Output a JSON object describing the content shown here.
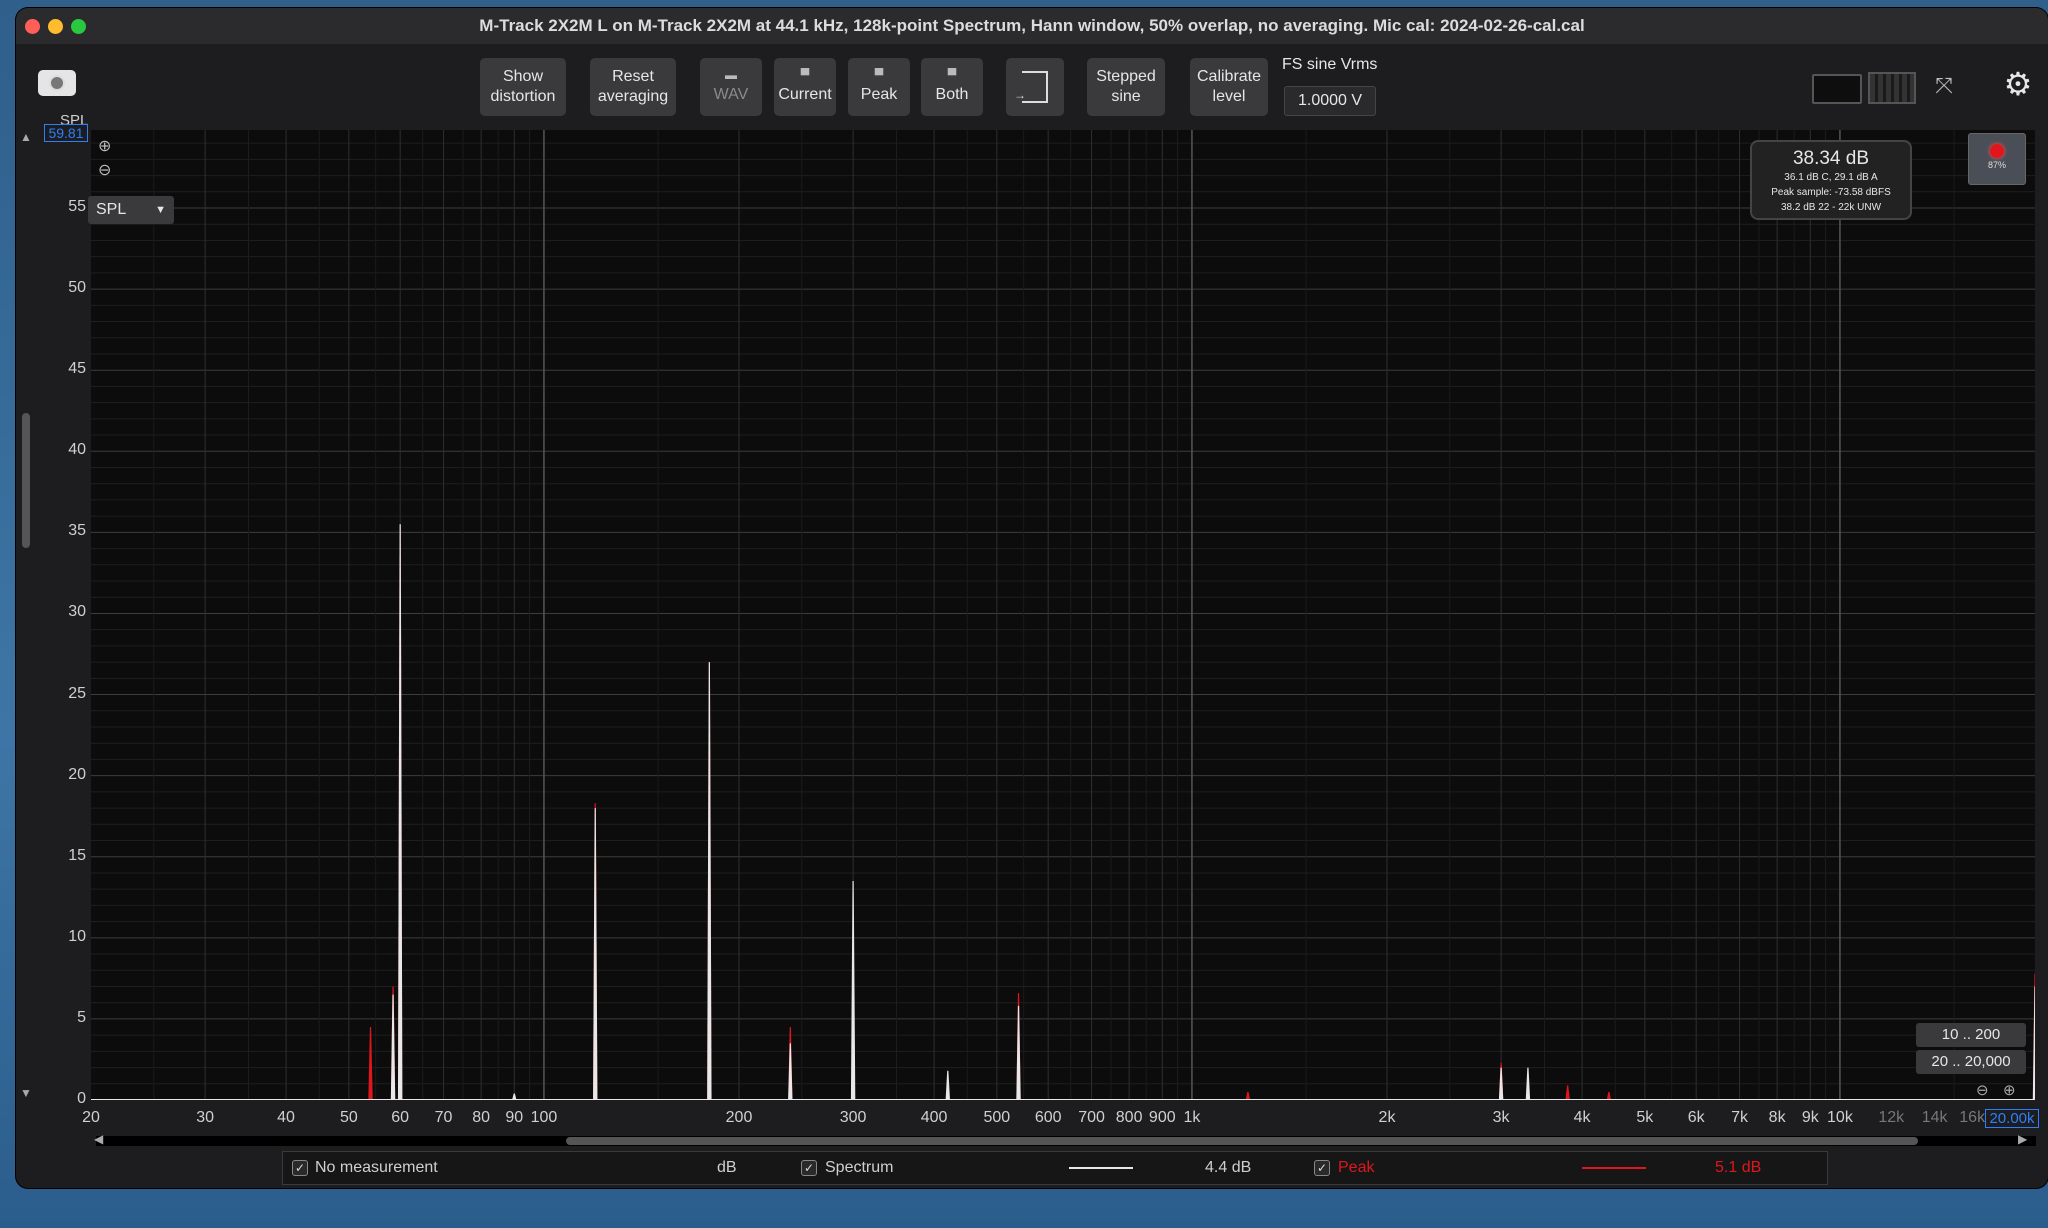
{
  "window": {
    "title": "M-Track 2X2M  L on M-Track 2X2M at 44.1 kHz, 128k-point Spectrum, Hann window, 50% overlap, no averaging. Mic cal: 2024-02-26-cal.cal"
  },
  "toolbar": {
    "show_distortion": "Show\ndistortion",
    "reset_averaging": "Reset\naveraging",
    "wav": "WAV",
    "current": "Current",
    "peak": "Peak",
    "both": "Both",
    "stepped_sine": "Stepped\nsine",
    "calibrate_level": "Calibrate\nlevel",
    "fs_label": "FS sine Vrms",
    "fs_value": "1.0000 V"
  },
  "plot": {
    "y_unit": "SPL",
    "y_max_value": "59.81",
    "y_selector": "SPL",
    "x_min_value": "20",
    "x_max_value": "20.00k",
    "y_ticks": [
      "55",
      "50",
      "45",
      "40",
      "35",
      "30",
      "25",
      "20",
      "15",
      "10",
      "5",
      "0"
    ],
    "x_ticks": [
      "20",
      "30",
      "40",
      "50",
      "60",
      "70",
      "80",
      "90",
      "100",
      "200",
      "300",
      "400",
      "500",
      "600",
      "700",
      "800",
      "900",
      "1k",
      "2k",
      "3k",
      "4k",
      "5k",
      "6k",
      "7k",
      "8k",
      "9k",
      "10k",
      "12k",
      "14k",
      "16k",
      "20.00k"
    ]
  },
  "level_box": {
    "main": "38.34 dB",
    "line1": "36.1 dB C, 29.1 dB A",
    "line2": "Peak sample: -73.58 dBFS",
    "line3": "38.2 dB 22 - 22k UNW"
  },
  "input_meter": {
    "percent": "87%"
  },
  "range_buttons": [
    "10 .. 200",
    "20 .. 20,000"
  ],
  "legend": {
    "no_measurement": "No measurement",
    "unit": "dB",
    "spectrum": "Spectrum",
    "spectrum_value": "4.4 dB",
    "peak": "Peak",
    "peak_value": "5.1 dB"
  },
  "colors": {
    "spectrum_trace": "#e8e8e8",
    "peak_trace": "#e0161c",
    "accent_blue": "#2d7ff9",
    "close": "#ff5f57",
    "minimize": "#febc2e",
    "zoom": "#28c840"
  },
  "chart_data": {
    "type": "line",
    "x_scale": "log",
    "xlim": [
      20,
      20000
    ],
    "ylim": [
      0,
      59.81
    ],
    "grid": true,
    "series": [
      {
        "name": "Spectrum",
        "x": [
          58.5,
          60,
          90,
          120,
          180,
          240,
          300,
          420,
          540,
          3000,
          3300,
          20000
        ],
        "values": [
          6.5,
          35.5,
          0.4,
          18.0,
          27.0,
          3.5,
          13.5,
          1.8,
          5.8,
          2.0,
          2.0,
          7.0
        ]
      },
      {
        "name": "Peak",
        "x": [
          54,
          58.5,
          60,
          120,
          180,
          240,
          540,
          1220,
          3000,
          3800,
          4400,
          20000
        ],
        "values": [
          4.5,
          7.0,
          35.5,
          18.3,
          27.0,
          4.5,
          6.6,
          0.5,
          2.3,
          0.9,
          0.5,
          7.8
        ]
      }
    ]
  }
}
